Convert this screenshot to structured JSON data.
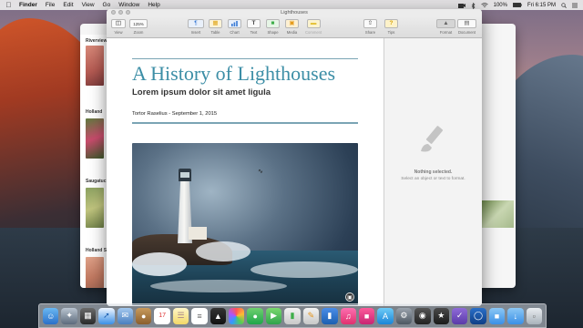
{
  "menubar": {
    "items": [
      "Finder",
      "File",
      "Edit",
      "View",
      "Go",
      "Window",
      "Help"
    ],
    "battery": "100%",
    "clock": "Fri 6:15 PM"
  },
  "back_window": {
    "sections": [
      "Riverview",
      "Holland",
      "Saugatuc",
      "Holland S"
    ]
  },
  "window": {
    "title": "Lighthouses",
    "toolbar": {
      "view_label": "View",
      "zoom_value": "125%",
      "zoom_label": "Zoom",
      "insert_label": "Insert",
      "table_label": "Table",
      "chart_label": "Chart",
      "text_label": "Text",
      "shape_label": "Shape",
      "media_label": "Media",
      "comment_label": "Comment",
      "share_label": "Share",
      "tips_label": "Tips",
      "format_label": "Format",
      "document_label": "Document"
    },
    "document": {
      "title": "A History of Lighthouses",
      "subtitle": "Lorem ipsum dolor sit amet ligula",
      "byline": "Tortor Raselius - September 1, 2015"
    },
    "inspector": {
      "empty_title": "Nothing selected.",
      "empty_hint": "Select an object or text to format."
    }
  },
  "colors": {
    "title_accent": "#3c8ea6",
    "rule": "#7aa4b4"
  }
}
